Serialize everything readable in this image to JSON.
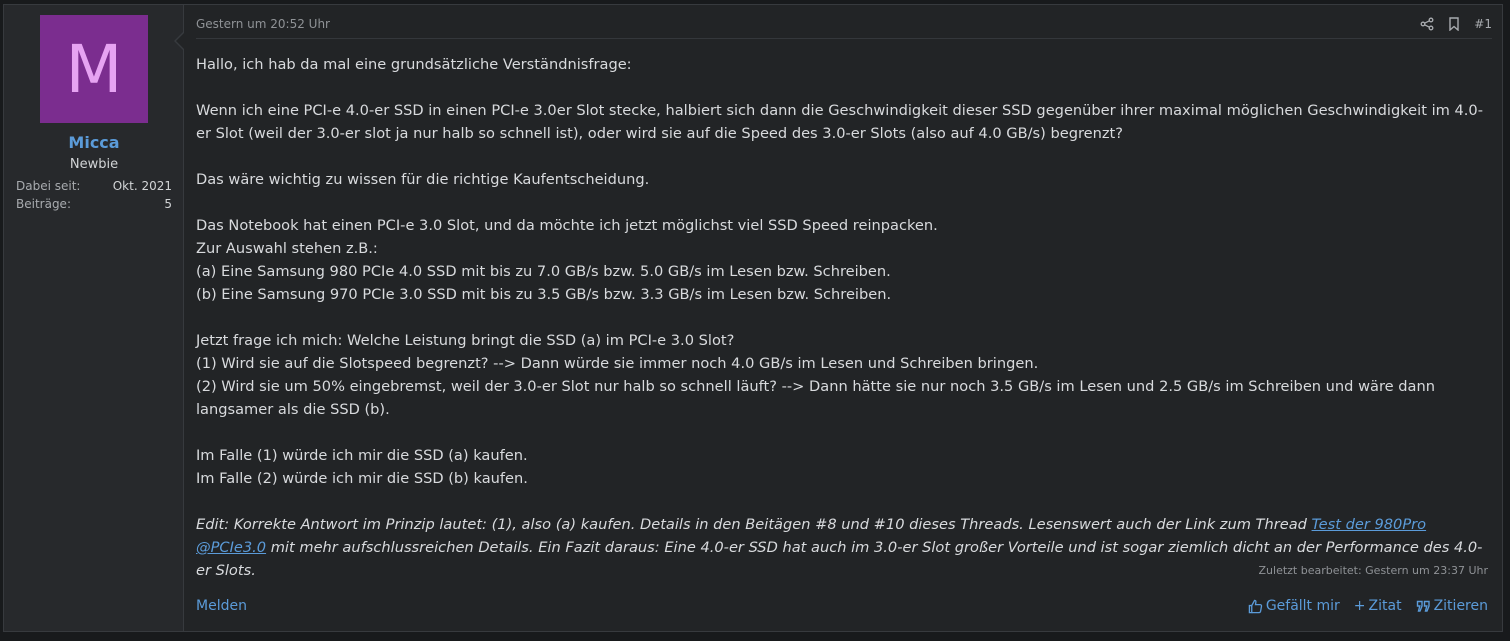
{
  "user": {
    "avatar_letter": "M",
    "name": "Micca",
    "title": "Newbie",
    "stats": [
      {
        "label": "Dabei seit:",
        "value": "Okt. 2021"
      },
      {
        "label": "Beiträge:",
        "value": "5"
      }
    ]
  },
  "post": {
    "date": "Gestern um 20:52 Uhr",
    "number": "#1",
    "lines": [
      "Hallo, ich hab da mal eine grundsätzliche Verständnisfrage:",
      "",
      "Wenn ich eine PCI-e 4.0-er SSD in einen PCI-e 3.0er Slot stecke, halbiert sich dann die Geschwindigkeit dieser SSD gegenüber ihrer maximal möglichen Geschwindigkeit im 4.0-er Slot (weil der 3.0-er slot ja nur halb so schnell ist), oder wird sie auf die Speed des 3.0-er Slots (also auf 4.0 GB/s) begrenzt?",
      "",
      "Das wäre wichtig zu wissen für die richtige Kaufentscheidung.",
      "",
      "Das Notebook hat einen PCI-e 3.0 Slot, und da möchte ich jetzt möglichst viel SSD Speed reinpacken.",
      "Zur Auswahl stehen z.B.:",
      "(a) Eine Samsung 980 PCIe 4.0 SSD mit bis zu 7.0 GB/s bzw. 5.0 GB/s im Lesen bzw. Schreiben.",
      "(b) Eine Samsung 970 PCIe 3.0 SSD mit bis zu 3.5 GB/s bzw. 3.3 GB/s im Lesen bzw. Schreiben.",
      "",
      "Jetzt frage ich mich: Welche Leistung bringt die SSD (a) im PCI-e 3.0 Slot?",
      "(1) Wird sie auf die Slotspeed begrenzt? --> Dann würde sie immer noch 4.0 GB/s im Lesen und Schreiben bringen.",
      "(2) Wird sie um 50% eingebremst, weil der 3.0-er Slot nur halb so schnell läuft? --> Dann hätte sie nur noch 3.5 GB/s im Lesen und 2.5 GB/s im Schreiben und wäre dann langsamer als die SSD (b).",
      "",
      "Im Falle (1) würde ich mir die SSD (a) kaufen.",
      "Im Falle (2) würde ich mir die SSD (b) kaufen.",
      ""
    ],
    "edit_prefix": "Edit: Korrekte Antwort im Prinzip lautet: (1), also (a) kaufen. Details in den Beitägen #8 und #10 dieses Threads. Lesenswert auch der Link zum Thread ",
    "edit_link": "Test der 980Pro @PCIe3.0",
    "edit_suffix": " mit mehr aufschlussreichen Details. Ein Fazit daraus: Eine 4.0-er SSD hat auch im 3.0-er Slot großer Vorteile und ist sogar ziemlich dicht an der Performance des 4.0-er Slots.",
    "last_edited": "Zuletzt bearbeitet: Gestern um 23:37 Uhr"
  },
  "footer": {
    "report": "Melden",
    "like": "Gefällt mir",
    "quote": "Zitat",
    "reply_quote": "Zitieren"
  },
  "colors": {
    "accent": "#5b9bd9",
    "avatar_bg": "#7b2d8f"
  }
}
